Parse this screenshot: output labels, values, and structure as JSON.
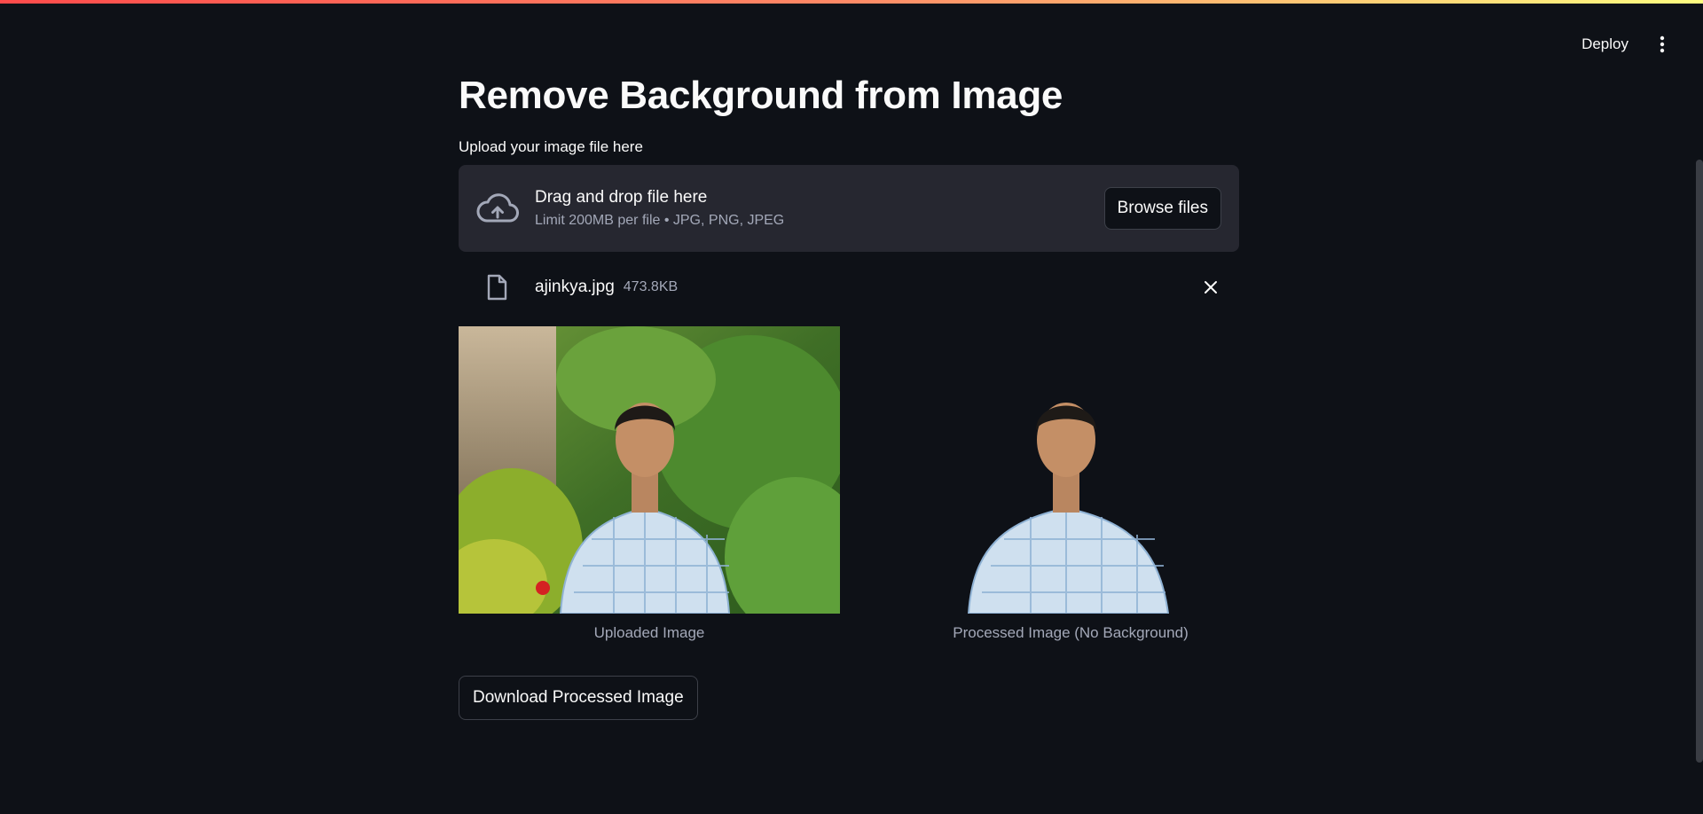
{
  "header": {
    "deploy_label": "Deploy",
    "menu_icon": "vertical-ellipsis-icon"
  },
  "main": {
    "title": "Remove Background from Image",
    "upload_label": "Upload your image file here",
    "dropzone": {
      "icon": "cloud-upload-icon",
      "main_text": "Drag and drop file here",
      "sub_text": "Limit 200MB per file • JPG, PNG, JPEG",
      "browse_label": "Browse files"
    },
    "file": {
      "icon": "file-icon",
      "name": "ajinkya.jpg",
      "size": "473.8KB",
      "remove_icon": "close-icon"
    },
    "images": {
      "uploaded_caption": "Uploaded Image",
      "processed_caption": "Processed Image (No Background)"
    },
    "download_label": "Download Processed Image"
  },
  "colors": {
    "background": "#0e1117",
    "surface": "#262730",
    "text": "#fafafa",
    "muted": "#a3a8b8",
    "accent_start": "#ff4b4b",
    "accent_end": "#fffd80"
  }
}
